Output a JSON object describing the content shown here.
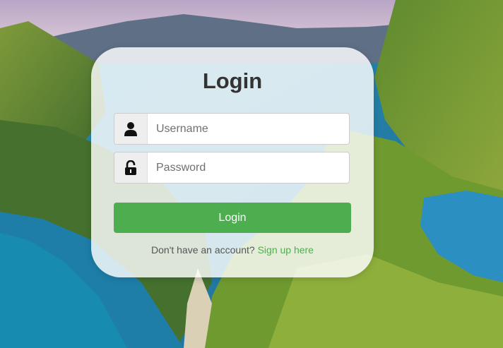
{
  "colors": {
    "accent": "#4cae4f",
    "link": "#4caf50",
    "title": "#333333"
  },
  "login": {
    "title": "Login",
    "username": {
      "placeholder": "Username",
      "value": "",
      "icon": "user-icon"
    },
    "password": {
      "placeholder": "Password",
      "value": "",
      "icon": "lock-icon"
    },
    "button_label": "Login",
    "signup_prompt": "Don't have an account?",
    "signup_link": "Sign up here"
  }
}
